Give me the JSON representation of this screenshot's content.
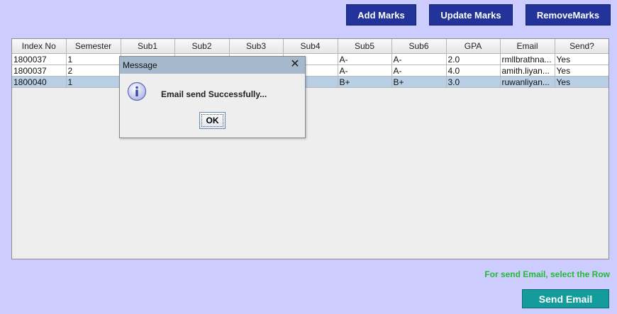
{
  "toolbar": {
    "add_label": "Add Marks",
    "update_label": "Update Marks",
    "remove_label": "RemoveMarks"
  },
  "table": {
    "columns": [
      "Index No",
      "Semester",
      "Sub1",
      "Sub2",
      "Sub3",
      "Sub4",
      "Sub5",
      "Sub6",
      "GPA",
      "Email",
      "Send?"
    ],
    "rows": [
      [
        "1800037",
        "1",
        "",
        "",
        "",
        "",
        "A-",
        "A-",
        "2.0",
        "rmllbrathna...",
        "Yes"
      ],
      [
        "1800037",
        "2",
        "",
        "",
        "",
        "",
        "A-",
        "A-",
        "4.0",
        "amith.liyan...",
        "Yes"
      ],
      [
        "1800040",
        "1",
        "",
        "",
        "",
        "",
        "B+",
        "B+",
        "3.0",
        "ruwanliyan...",
        "Yes"
      ]
    ],
    "selected_row": 2
  },
  "hint_text": "For send Email, select the Row",
  "send_label": "Send Email",
  "dialog": {
    "title": "Message",
    "message": "Email send Successfully...",
    "ok_label": "OK",
    "icon": "information-icon"
  },
  "colors": {
    "background": "#ccccff",
    "top_button": "#223399",
    "send_button": "#149b9b",
    "hint": "#22bb33",
    "selection": "#b8cfe5"
  }
}
